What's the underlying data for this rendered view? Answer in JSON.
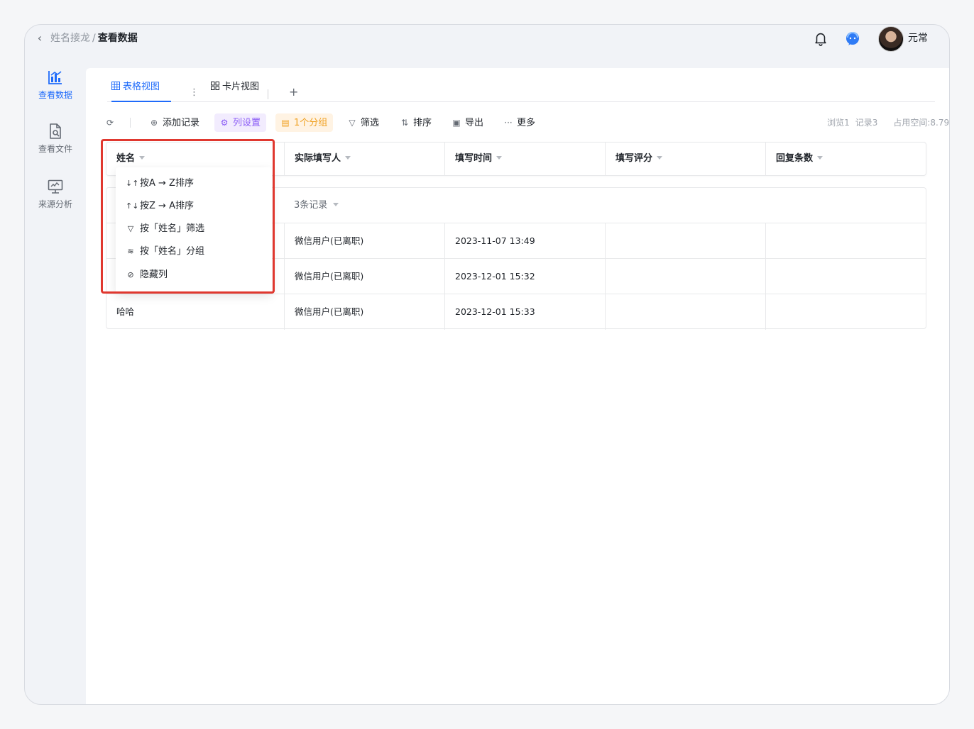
{
  "header": {
    "breadcrumb_parent": "姓名接龙",
    "breadcrumb_sep": "/",
    "breadcrumb_current": "查看数据",
    "username": "元常"
  },
  "sidebar": {
    "items": [
      {
        "label": "查看数据",
        "icon": "chart-icon",
        "active": true
      },
      {
        "label": "查看文件",
        "icon": "file-search-icon",
        "active": false
      },
      {
        "label": "来源分析",
        "icon": "monitor-icon",
        "active": false
      }
    ]
  },
  "tabs": [
    {
      "label": "表格视图",
      "icon": "grid-icon",
      "active": true
    },
    {
      "label": "卡片视图",
      "icon": "card-icon",
      "active": false
    }
  ],
  "toolbar": {
    "refresh_icon": "refresh-icon",
    "add_record": "添加记录",
    "column_settings": "列设置",
    "group": "1个分组",
    "filter": "筛选",
    "sort": "排序",
    "export": "导出",
    "more": "更多"
  },
  "stats": {
    "views": "浏览1",
    "records": "记录3",
    "space": "占用空间:8.79K"
  },
  "table": {
    "columns": [
      "姓名",
      "实际填写人",
      "填写时间",
      "填写评分",
      "回复条数"
    ],
    "group_label": "3条记录",
    "rows": [
      {
        "name": "",
        "filler": "微信用户(已离职)",
        "time": "2023-11-07 13:49",
        "score": "",
        "replies": ""
      },
      {
        "name": "",
        "filler": "微信用户(已离职)",
        "time": "2023-12-01 15:32",
        "score": "",
        "replies": ""
      },
      {
        "name": "哈哈",
        "filler": "微信用户(已离职)",
        "time": "2023-12-01 15:33",
        "score": "",
        "replies": ""
      }
    ]
  },
  "column_menu": {
    "items": [
      {
        "label": "按A → Z排序",
        "icon": "sort-asc-icon"
      },
      {
        "label": "按Z → A排序",
        "icon": "sort-desc-icon"
      },
      {
        "label": "按「姓名」筛选",
        "icon": "filter-icon"
      },
      {
        "label": "按「姓名」分组",
        "icon": "group-icon"
      },
      {
        "label": "隐藏列",
        "icon": "eye-off-icon"
      }
    ]
  },
  "colors": {
    "accent": "#1f6bfa",
    "highlight": "#e0382f",
    "purple": "#8b5cf6",
    "orange": "#f0a020"
  }
}
